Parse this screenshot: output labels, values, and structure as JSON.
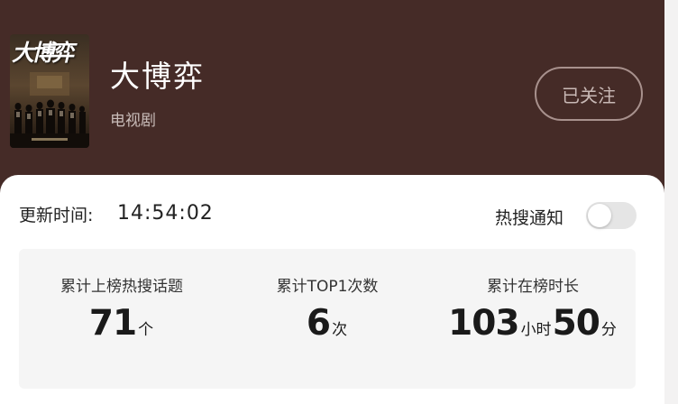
{
  "show": {
    "title": "大博弈",
    "type": "电视剧",
    "poster_title": "大博弈",
    "follow_label": "已关注"
  },
  "update": {
    "label": "更新时间:",
    "time": "14:54:02"
  },
  "notify": {
    "label": "热搜通知",
    "enabled": false
  },
  "stats": [
    {
      "label": "累计上榜热搜话题",
      "value": "71",
      "unit": "个"
    },
    {
      "label": "累计TOP1次数",
      "value": "6",
      "unit": "次"
    },
    {
      "label": "累计在榜时长",
      "hours": "103",
      "hours_unit": "小时",
      "minutes": "50",
      "minutes_unit": "分"
    }
  ],
  "colors": {
    "header_bg": "#452b27",
    "card_bg": "#ffffff",
    "panel_bg": "#f5f5f5",
    "toggle_off": "#e5e5e5"
  }
}
